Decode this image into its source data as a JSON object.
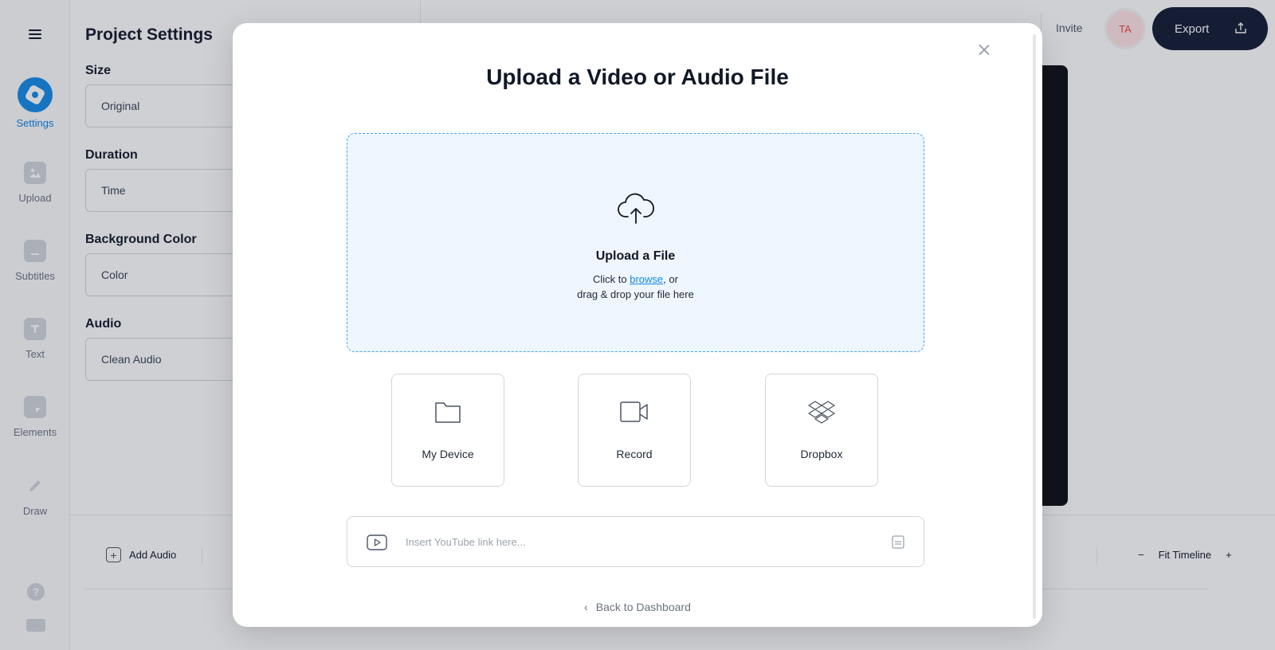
{
  "sidebar": {
    "items": [
      {
        "label": "Settings",
        "icon": "settings-icon",
        "active": true
      },
      {
        "label": "Upload",
        "icon": "image-icon"
      },
      {
        "label": "Subtitles",
        "icon": "subtitles-icon"
      },
      {
        "label": "Text",
        "icon": "text-icon"
      },
      {
        "label": "Elements",
        "icon": "elements-icon"
      },
      {
        "label": "Draw",
        "icon": "pencil-icon"
      }
    ]
  },
  "panel": {
    "title": "Project Settings",
    "size_label": "Size",
    "size_value": "Original",
    "duration_label": "Duration",
    "duration_value": "Time",
    "bg_label": "Background Color",
    "bg_value": "Color",
    "audio_label": "Audio",
    "audio_value": "Clean Audio"
  },
  "topbar": {
    "invite": "Invite",
    "avatar_initials": "TA",
    "export": "Export"
  },
  "timeline": {
    "add_audio": "Add Audio",
    "fit_timeline": "Fit Timeline",
    "zoom_out": "−",
    "zoom_in": "+"
  },
  "modal": {
    "title": "Upload a Video or Audio File",
    "dropzone": {
      "title": "Upload a File",
      "line1_prefix": "Click to ",
      "line1_link": "browse",
      "line1_suffix": ", or",
      "line2": "drag & drop your file here"
    },
    "sources": [
      {
        "label": "My Device",
        "icon": "folder-icon"
      },
      {
        "label": "Record",
        "icon": "video-camera-icon"
      },
      {
        "label": "Dropbox",
        "icon": "dropbox-icon"
      }
    ],
    "youtube_placeholder": "Insert YouTube link here...",
    "back_link": "Back to Dashboard"
  },
  "colors": {
    "accent": "#1389e6",
    "export_bg": "#111a33",
    "dropzone_bg": "#eef6ff"
  }
}
